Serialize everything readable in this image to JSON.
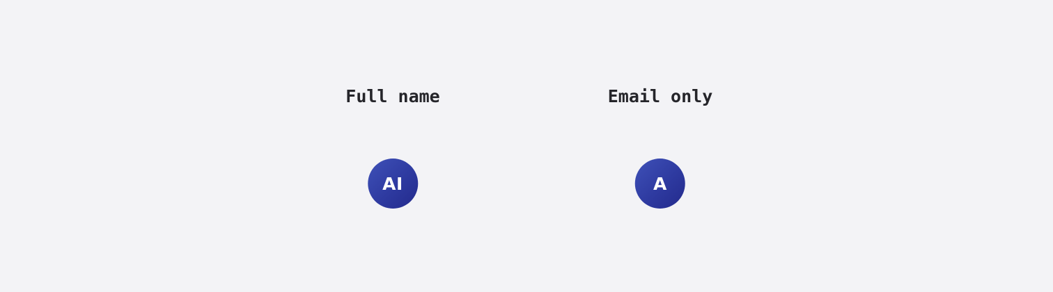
{
  "examples": [
    {
      "caption": "Full name",
      "initials": "AI"
    },
    {
      "caption": "Email only",
      "initials": "A"
    }
  ],
  "colors": {
    "background": "#f3f3f6",
    "caption_text": "#25252a",
    "avatar_gradient_start": "#3f51b8",
    "avatar_gradient_end": "#232a8c",
    "avatar_text": "#ffffff"
  }
}
